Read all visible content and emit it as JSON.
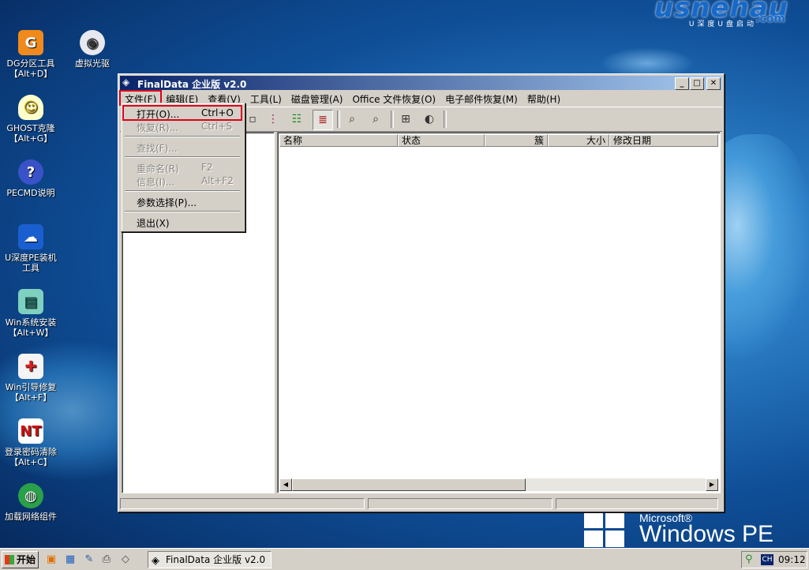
{
  "desktop": {
    "brand": {
      "main": "usnehau",
      "sub": "U深度U盘启动",
      "com": ".com"
    },
    "winpe": {
      "ms": "Microsoft®",
      "text": "Windows PE"
    },
    "icons": [
      {
        "label": "DG分区工具",
        "sub": "【Alt+D】",
        "icon": "partition-icon"
      },
      {
        "label": "虚拟光驱",
        "sub": "",
        "icon": "virtual-drive-icon"
      },
      {
        "label": "GHOST克隆",
        "sub": "【Alt+G】",
        "icon": "ghost-icon"
      },
      {
        "label": "PECMD说明",
        "sub": "",
        "icon": "help-icon"
      },
      {
        "label": "U深度PE装机",
        "sub": "工具",
        "icon": "installer-icon"
      },
      {
        "label": "Win系统安装",
        "sub": "【Alt+W】",
        "icon": "win-install-icon"
      },
      {
        "label": "Win引导修复",
        "sub": "【Alt+F】",
        "icon": "boot-repair-icon"
      },
      {
        "label": "登录密码清除",
        "sub": "【Alt+C】",
        "icon": "password-clear-icon"
      },
      {
        "label": "加载网络组件",
        "sub": "",
        "icon": "network-icon"
      }
    ]
  },
  "window": {
    "title": "FinalData 企业版 v2.0",
    "menu": [
      "文件(F)",
      "编辑(E)",
      "查看(V)",
      "工具(L)",
      "磁盘管理(A)",
      "Office 文件恢复(O)",
      "电子邮件恢复(M)",
      "帮助(H)"
    ],
    "columns": [
      "名称",
      "状态",
      "簇",
      "大小",
      "修改日期"
    ]
  },
  "file_menu": {
    "items": [
      {
        "label": "打开(O)...",
        "shortcut": "Ctrl+O"
      },
      {
        "label": "恢复(R)...",
        "shortcut": "Ctrl+S"
      },
      {
        "label": "查找(F)...",
        "shortcut": ""
      },
      {
        "label": "重命名(R)",
        "shortcut": "F2"
      },
      {
        "label": "信息(I)...",
        "shortcut": "Alt+F2"
      },
      {
        "label": "参数选择(P)...",
        "shortcut": ""
      },
      {
        "label": "退出(X)",
        "shortcut": ""
      }
    ]
  },
  "taskbar": {
    "start": "开始",
    "task": "FinalData 企业版 v2.0",
    "ime": "CH",
    "clock": "09:12"
  }
}
